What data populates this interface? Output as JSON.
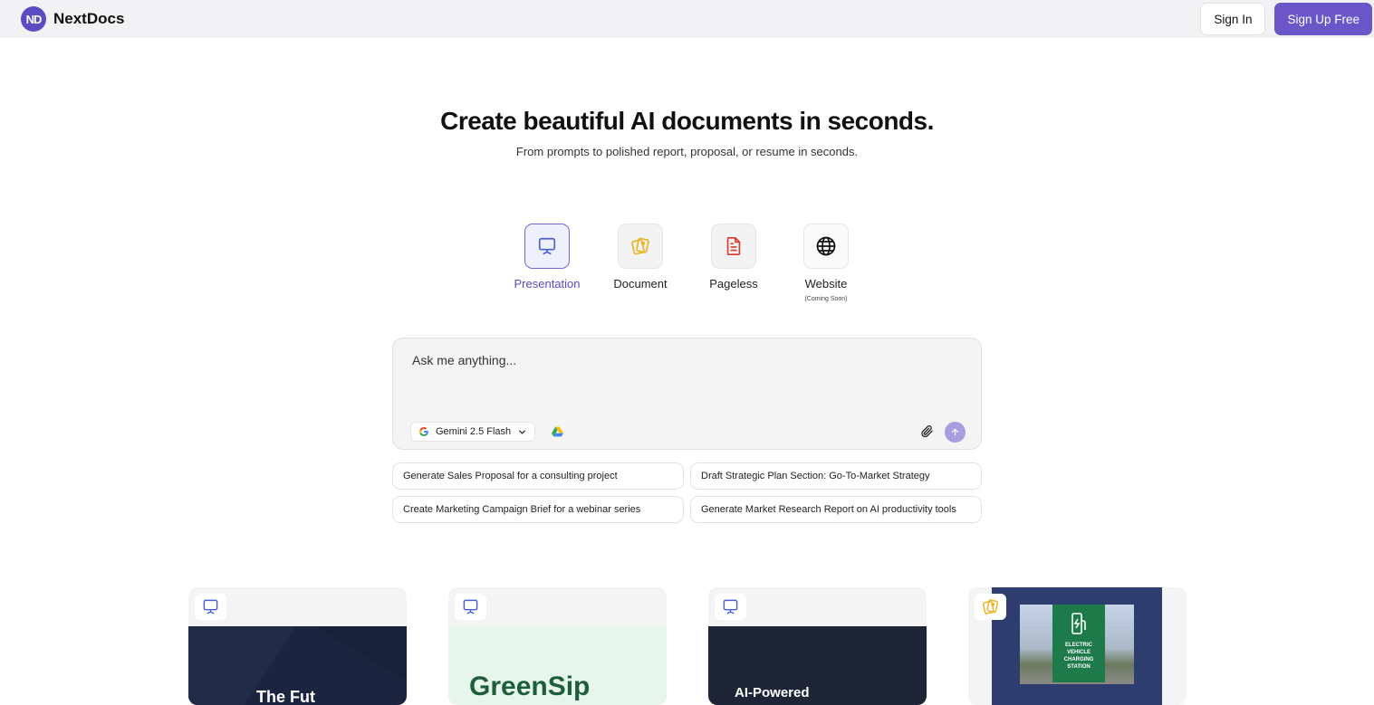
{
  "header": {
    "logo_text": "ND",
    "brand": "NextDocs",
    "sign_in": "Sign In",
    "sign_up": "Sign Up Free",
    "accent": "#6a55c9"
  },
  "hero": {
    "title": "Create beautiful AI documents in seconds.",
    "subtitle": "From prompts to polished report, proposal, or resume in seconds."
  },
  "modes": [
    {
      "label": "Presentation",
      "icon": "presentation-icon",
      "active": true
    },
    {
      "label": "Document",
      "icon": "document-cards-icon",
      "active": false
    },
    {
      "label": "Pageless",
      "icon": "pageless-file-icon",
      "active": false
    },
    {
      "label": "Website",
      "icon": "globe-icon",
      "active": false,
      "note": "(Coming Soon)"
    }
  ],
  "prompt": {
    "placeholder": "Ask me anything...",
    "model": "Gemini 2.5 Flash"
  },
  "suggestions": [
    "Generate Sales Proposal for a consulting project",
    "Draft Strategic Plan Section: Go-To-Market Strategy",
    "Create Marketing Campaign Brief for a webinar series",
    "Generate Market Research Report on AI productivity tools"
  ],
  "cards": [
    {
      "type_icon": "presentation-icon",
      "title": "The Fut",
      "bg": "#1b2540"
    },
    {
      "type_icon": "presentation-icon",
      "title": "GreenSip",
      "bg": "#e6f6ec"
    },
    {
      "type_icon": "presentation-icon",
      "title": "AI-Powered",
      "bg": "#1e2536"
    },
    {
      "type_icon": "document-cards-icon",
      "sign_text": "ELECTRIC VEHICLE CHARGING STATION",
      "bg": "#2c3d6e"
    }
  ]
}
